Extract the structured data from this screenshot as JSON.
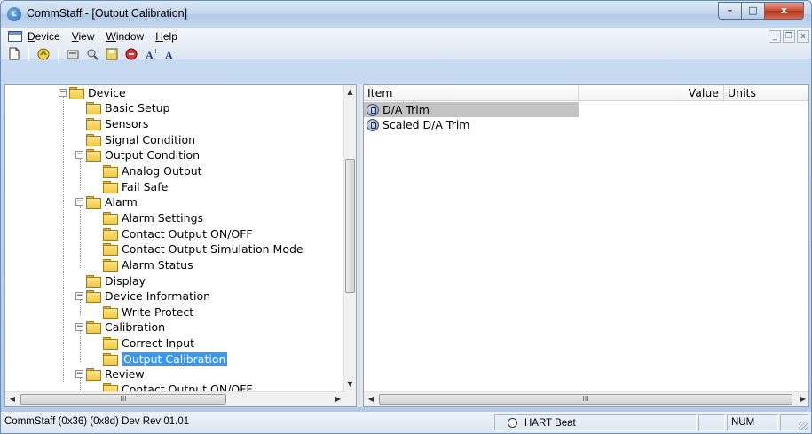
{
  "window": {
    "title": "CommStaff - [Output Calibration]",
    "app_icon": "commstaff-logo-icon",
    "caption_buttons": {
      "minimize": "–",
      "maximize": "□",
      "close": "x"
    }
  },
  "menu": {
    "items": [
      {
        "label": "Device",
        "accel": "D"
      },
      {
        "label": "View",
        "accel": "V"
      },
      {
        "label": "Window",
        "accel": "W"
      },
      {
        "label": "Help",
        "accel": "H"
      }
    ],
    "mdi_buttons": {
      "minimize": "_",
      "restore": "❐",
      "close": "x"
    }
  },
  "toolbar": {
    "buttons": [
      {
        "name": "new-icon",
        "glyph": "🗋"
      },
      {
        "name": "connect-icon",
        "glyph": "🔗"
      },
      {
        "name": "read-device-icon",
        "glyph": "🖫"
      },
      {
        "name": "find-device-icon",
        "glyph": "🔍"
      },
      {
        "name": "save-config-icon",
        "glyph": "💾"
      },
      {
        "name": "stop-icon",
        "glyph": "⛔"
      },
      {
        "name": "font-increase-icon",
        "glyph": "A⁺"
      },
      {
        "name": "font-decrease-icon",
        "glyph": "A⁻"
      }
    ]
  },
  "tree": {
    "nodes": [
      {
        "label": "Device",
        "level": 0,
        "expander": "−"
      },
      {
        "label": "Basic Setup",
        "level": 1,
        "expander": ""
      },
      {
        "label": "Sensors",
        "level": 1,
        "expander": ""
      },
      {
        "label": "Signal Condition",
        "level": 1,
        "expander": ""
      },
      {
        "label": "Output Condition",
        "level": 1,
        "expander": "−"
      },
      {
        "label": "Analog Output",
        "level": 2,
        "expander": ""
      },
      {
        "label": "Fail Safe",
        "level": 2,
        "expander": ""
      },
      {
        "label": "Alarm",
        "level": 1,
        "expander": "−"
      },
      {
        "label": "Alarm Settings",
        "level": 2,
        "expander": ""
      },
      {
        "label": "Contact Output ON/OFF",
        "level": 2,
        "expander": ""
      },
      {
        "label": "Contact Output Simulation Mode",
        "level": 2,
        "expander": ""
      },
      {
        "label": "Alarm Status",
        "level": 2,
        "expander": ""
      },
      {
        "label": "Display",
        "level": 1,
        "expander": ""
      },
      {
        "label": "Device Information",
        "level": 1,
        "expander": "−"
      },
      {
        "label": "Write Protect",
        "level": 2,
        "expander": ""
      },
      {
        "label": "Calibration",
        "level": 1,
        "expander": "−"
      },
      {
        "label": "Correct Input",
        "level": 2,
        "expander": ""
      },
      {
        "label": "Output Calibration",
        "level": 2,
        "expander": "",
        "selected": true
      },
      {
        "label": "Review",
        "level": 1,
        "expander": "−"
      },
      {
        "label": "Contact Output ON/OFF",
        "level": 2,
        "expander": ""
      }
    ],
    "hscroll_grip": "III"
  },
  "list": {
    "columns": {
      "item": "Item",
      "value": "Value",
      "units": "Units"
    },
    "rows": [
      {
        "item": "D/A Trim",
        "value": "",
        "units": "",
        "selected": true
      },
      {
        "item": "Scaled D/A Trim",
        "value": "",
        "units": "",
        "selected": false
      }
    ],
    "hscroll_grip": "III"
  },
  "status": {
    "left_text": "CommStaff  (0x36)  (0x8d) Dev Rev 01.01",
    "heartbeat": "HART Beat",
    "num": "NUM"
  }
}
